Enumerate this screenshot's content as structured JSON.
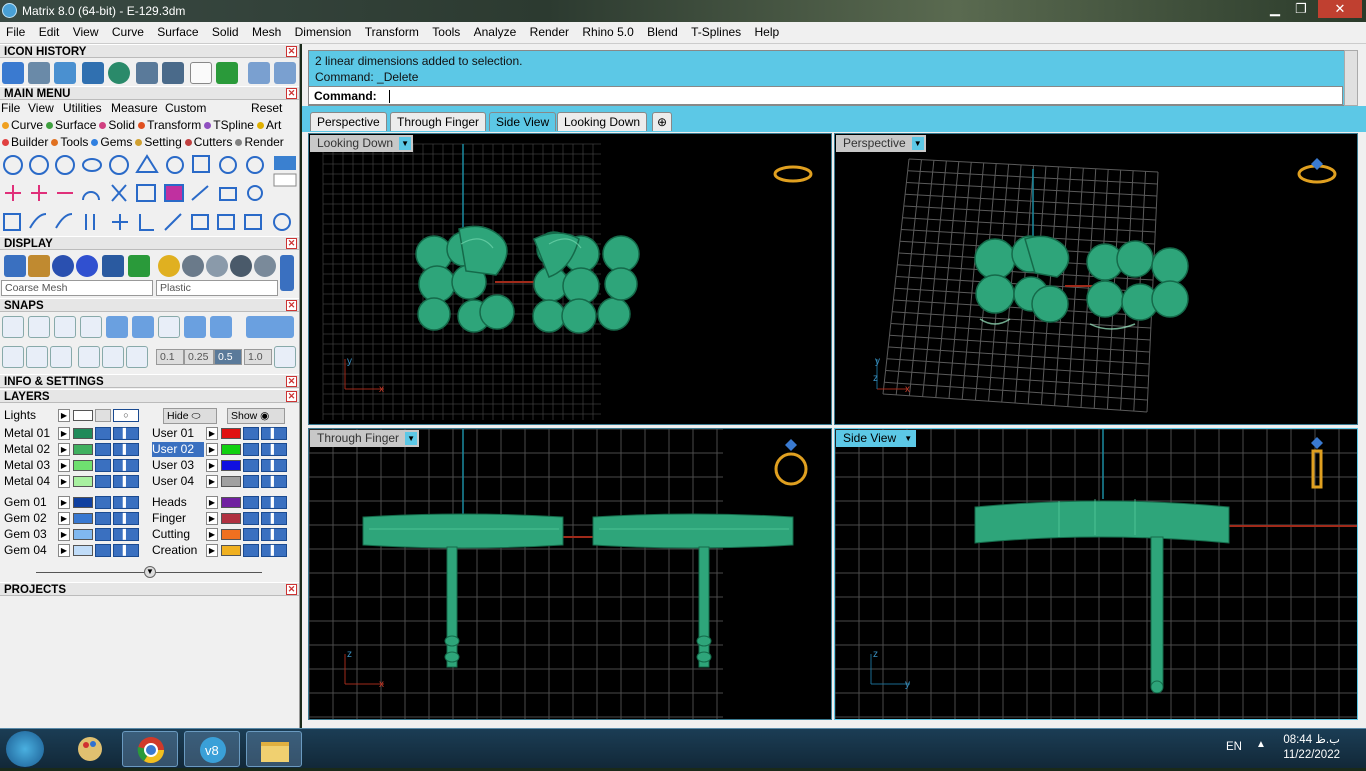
{
  "window": {
    "title": "Matrix 8.0 (64-bit) - E-129.3dm",
    "min": "▁",
    "max": "❐",
    "close": "✕"
  },
  "menubar": [
    "File",
    "Edit",
    "View",
    "Curve",
    "Surface",
    "Solid",
    "Mesh",
    "Dimension",
    "Transform",
    "Tools",
    "Analyze",
    "Render",
    "Rhino 5.0",
    "Blend",
    "T-Splines",
    "Help"
  ],
  "left": {
    "icon_history": "ICON HISTORY",
    "main_menu": "MAIN MENU",
    "main_menu_items": [
      "File",
      "View",
      "Utilities",
      "Measure",
      "Custom"
    ],
    "reset": "Reset",
    "categories1": [
      {
        "label": "Curve",
        "color": "#f0a020"
      },
      {
        "label": "Surface",
        "color": "#40a040"
      },
      {
        "label": "Solid",
        "color": "#d04080"
      },
      {
        "label": "Transform",
        "color": "#e05020"
      },
      {
        "label": "TSpline",
        "color": "#9050c0"
      },
      {
        "label": "Art",
        "color": "#e0b000"
      }
    ],
    "categories2": [
      {
        "label": "Builder",
        "color": "#e04040"
      },
      {
        "label": "Tools",
        "color": "#e07020"
      },
      {
        "label": "Gems",
        "color": "#3080e0"
      },
      {
        "label": "Setting",
        "color": "#d0a030"
      },
      {
        "label": "Cutters",
        "color": "#c04040"
      },
      {
        "label": "Render",
        "color": "#808080"
      }
    ],
    "display": "DISPLAY",
    "mesh_select": "Coarse Mesh",
    "material_select": "Plastic",
    "snaps": "SNAPS",
    "snap_values": [
      "0.1",
      "0.25",
      "0.5",
      "1.0"
    ],
    "info": "INFO & SETTINGS",
    "layers": "LAYERS",
    "lights": "Lights",
    "hide": "Hide",
    "show": "Show",
    "layers_left": [
      {
        "name": "Metal 01",
        "color": "#1f8a5a"
      },
      {
        "name": "Metal 02",
        "color": "#3fb060"
      },
      {
        "name": "Metal 03",
        "color": "#6fe070"
      },
      {
        "name": "Metal 04",
        "color": "#a8f0a0"
      },
      {
        "name": "Gem 01",
        "color": "#1040a0"
      },
      {
        "name": "Gem 02",
        "color": "#3878d0"
      },
      {
        "name": "Gem 03",
        "color": "#80b8f0"
      },
      {
        "name": "Gem 04",
        "color": "#c0dcf8"
      }
    ],
    "layers_right": [
      {
        "name": "User 01",
        "color": "#e01010"
      },
      {
        "name": "User 02",
        "color": "#10d010"
      },
      {
        "name": "User 03",
        "color": "#1010e0"
      },
      {
        "name": "User 04",
        "color": "#a0a0a0"
      },
      {
        "name": "Heads",
        "color": "#7020a0"
      },
      {
        "name": "Finger",
        "color": "#b03040"
      },
      {
        "name": "Cutting",
        "color": "#f07020"
      },
      {
        "name": "Creation",
        "color": "#f0b020"
      }
    ],
    "projects": "PROJECTS"
  },
  "command": {
    "line1": "2 linear dimensions added to selection.",
    "line2": "Command: _Delete",
    "prompt": "Command:"
  },
  "tabs": [
    "Perspective",
    "Through Finger",
    "Side View",
    "Looking Down"
  ],
  "active_tab": "Side View",
  "viewports": {
    "tl": "Looking Down",
    "tr": "Perspective",
    "bl": "Through Finger",
    "br": "Side View"
  },
  "axes": {
    "x": "x",
    "y": "y",
    "z": "z"
  },
  "taskbar": {
    "lang": "EN",
    "time": "08:44 ب.ظ",
    "date": "11/22/2022"
  },
  "colors": {
    "accent": "#5cc8e6",
    "model": "#2aa37a",
    "grid": "#555555"
  }
}
